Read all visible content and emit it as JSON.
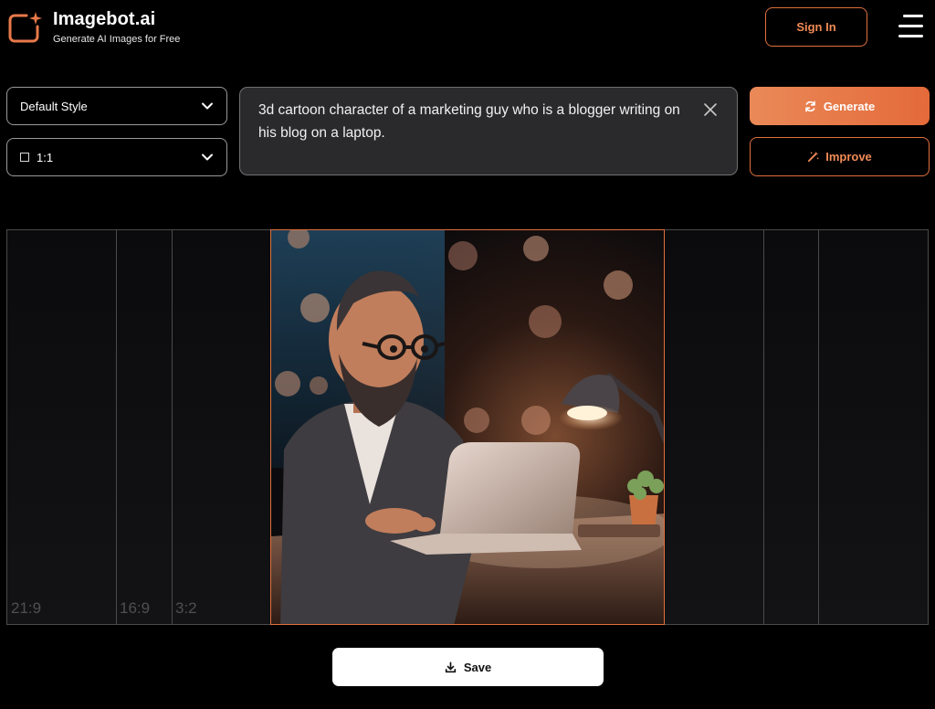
{
  "brand": {
    "name": "Imagebot.ai",
    "tagline": "Generate AI Images for Free",
    "accent": "#e46a3a"
  },
  "header": {
    "signin_label": "Sign In",
    "menu_icon": "hamburger-menu-icon"
  },
  "controls": {
    "style_select": {
      "value": "Default Style",
      "icon": "chevron-down-icon"
    },
    "ratio_select": {
      "value": "1:1",
      "icon": "chevron-down-icon"
    },
    "prompt": {
      "value": "3d cartoon character of a marketing guy who is a blogger writing on his blog on a laptop.",
      "clear_icon": "close-icon"
    },
    "generate_label": "Generate",
    "generate_icon": "refresh-icon",
    "improve_label": "Improve",
    "improve_icon": "magic-wand-icon"
  },
  "canvas": {
    "ratio_labels": [
      "21:9",
      "16:9",
      "3:2"
    ],
    "image_alt": "3D cartoon bearded man with glasses typing on a laptop at a desk under a lamp"
  },
  "save_label": "Save",
  "save_icon": "download-icon"
}
